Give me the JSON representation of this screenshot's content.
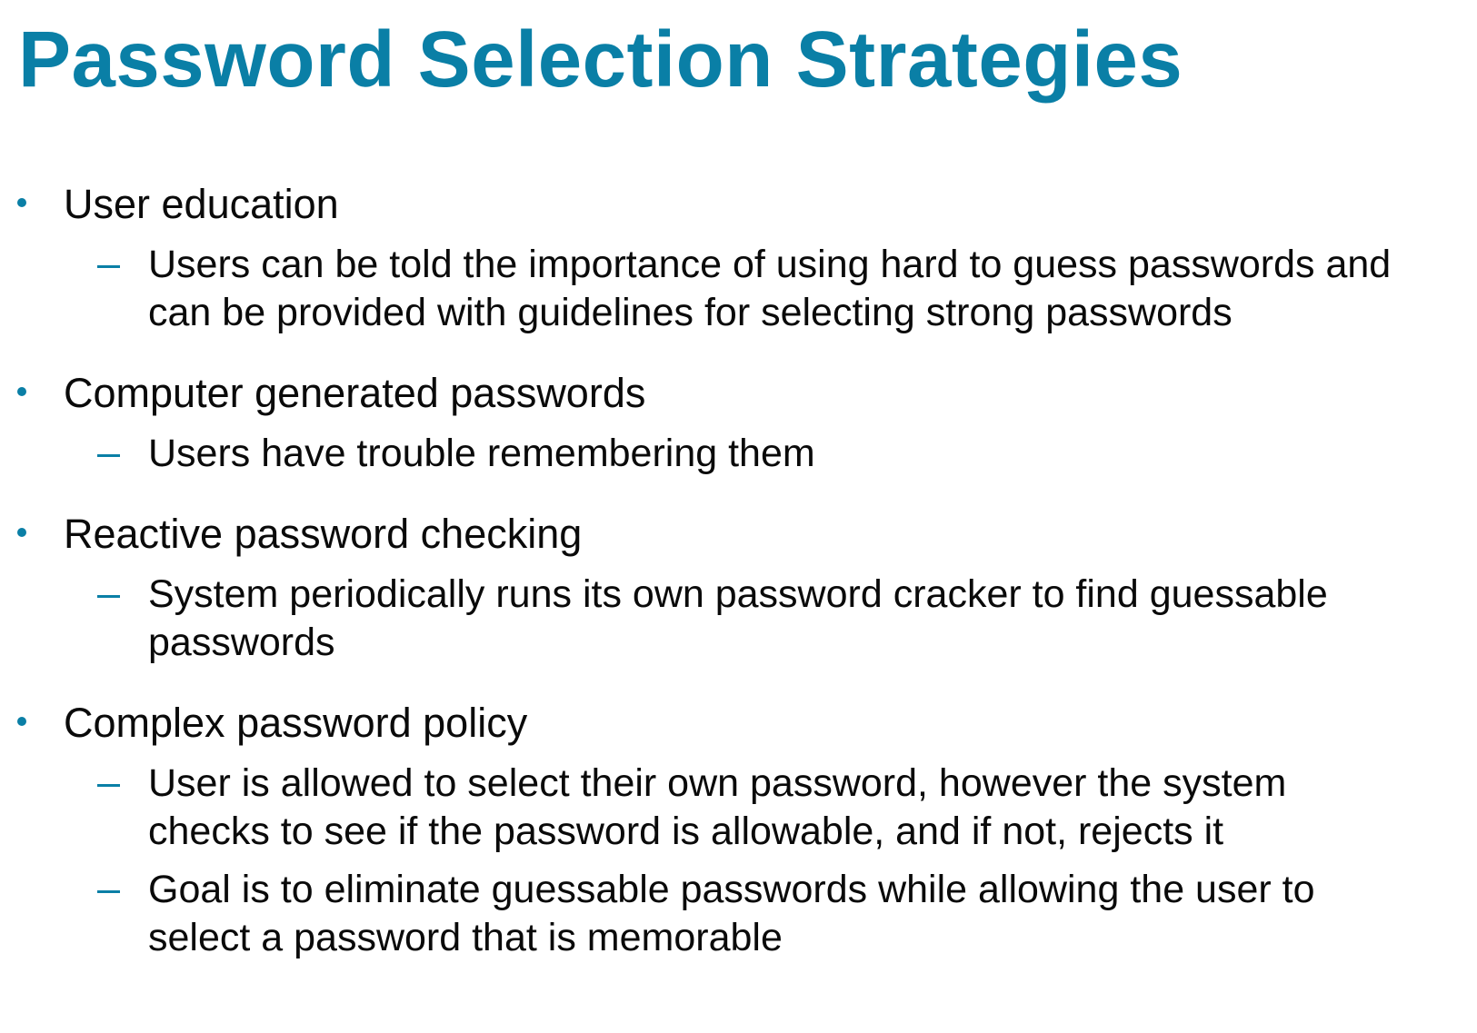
{
  "slide": {
    "title": "Password Selection Strategies",
    "accent_color": "#0a7fa6",
    "bullets": [
      {
        "label": "User education",
        "subs": [
          "Users can be told the importance of using hard to guess passwords and can be provided with guidelines for selecting strong passwords"
        ]
      },
      {
        "label": "Computer generated passwords",
        "subs": [
          "Users have trouble remembering them"
        ]
      },
      {
        "label": "Reactive password checking",
        "subs": [
          "System periodically runs its own password cracker to find guessable passwords"
        ]
      },
      {
        "label": "Complex password policy",
        "subs": [
          "User is allowed to select their own password, however the system checks to see if the password is allowable, and if  not, rejects it",
          "Goal is to  eliminate guessable passwords while allowing the user to select a password that is memorable"
        ]
      }
    ]
  }
}
